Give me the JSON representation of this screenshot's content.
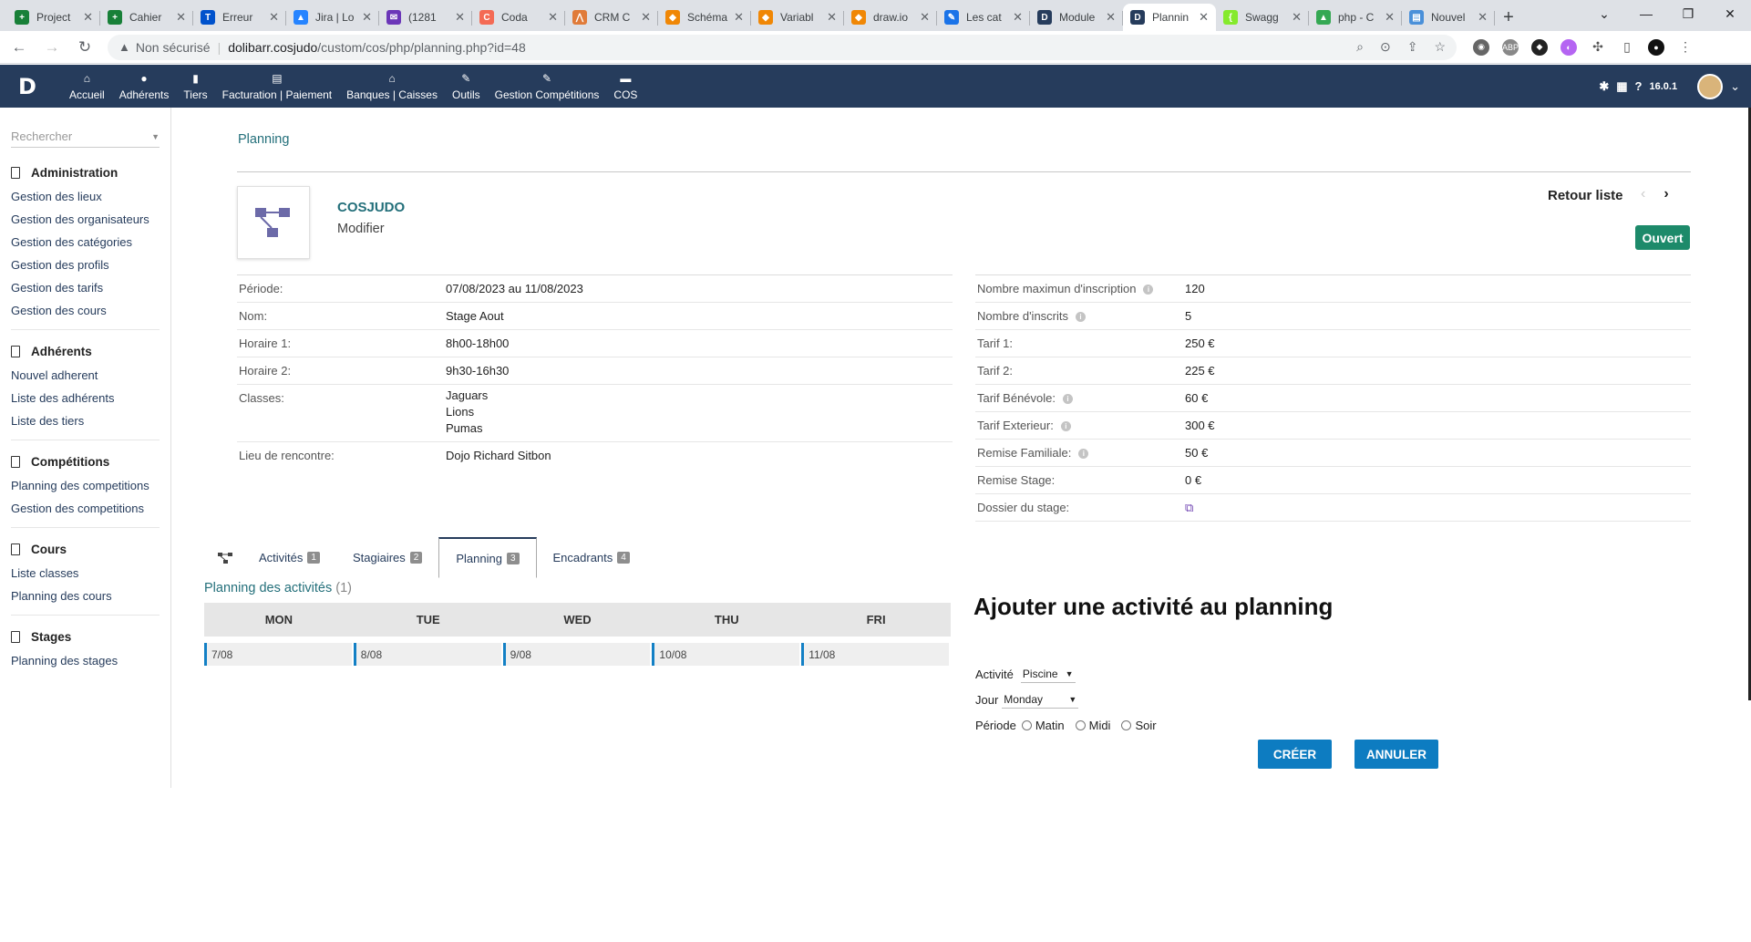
{
  "browser": {
    "tabs": [
      {
        "title": "Project",
        "color": "#188038",
        "glyph": "+"
      },
      {
        "title": "Cahier",
        "color": "#188038",
        "glyph": "+"
      },
      {
        "title": "Erreur",
        "color": "#0052cc",
        "glyph": "T"
      },
      {
        "title": "Jira | Lo",
        "color": "#2684ff",
        "glyph": "▲"
      },
      {
        "title": "(1281",
        "color": "#6b36b8",
        "glyph": "✉"
      },
      {
        "title": "Coda",
        "color": "#f46a54",
        "glyph": "C"
      },
      {
        "title": "CRM C",
        "color": "#e07b39",
        "glyph": "⋀"
      },
      {
        "title": "Schéma",
        "color": "#f08705",
        "glyph": "◆"
      },
      {
        "title": "Variabl",
        "color": "#f08705",
        "glyph": "◆"
      },
      {
        "title": "draw.io",
        "color": "#f08705",
        "glyph": "◆"
      },
      {
        "title": "Les cat",
        "color": "#1a73e8",
        "glyph": "✎"
      },
      {
        "title": "Module",
        "color": "#263c5c",
        "glyph": "D"
      },
      {
        "title": "Plannin",
        "color": "#263c5c",
        "glyph": "D"
      },
      {
        "title": "Swagg",
        "color": "#85ea2d",
        "glyph": "{"
      },
      {
        "title": "php - C",
        "color": "#34a853",
        "glyph": "▲"
      },
      {
        "title": "Nouvel",
        "color": "#4a90d9",
        "glyph": "▤"
      }
    ],
    "active_tab_index": 12,
    "new_tab": "+",
    "security_label": "Non sécurisé",
    "url_host": "dolibarr.cosjudo",
    "url_path": "/custom/cos/php/planning.php?id=48"
  },
  "topmenu": {
    "items": [
      {
        "label": "Accueil",
        "icon": "home-icon",
        "glyph": "⌂"
      },
      {
        "label": "Adhérents",
        "icon": "user-icon",
        "glyph": "●"
      },
      {
        "label": "Tiers",
        "icon": "building-icon",
        "glyph": "▮"
      },
      {
        "label": "Facturation | Paiement",
        "icon": "money-icon",
        "glyph": "▤"
      },
      {
        "label": "Banques | Caisses",
        "icon": "bank-icon",
        "glyph": "⌂"
      },
      {
        "label": "Outils",
        "icon": "wrench-icon",
        "glyph": "✎"
      },
      {
        "label": "Gestion Compétitions",
        "icon": "edit-icon",
        "glyph": "✎"
      },
      {
        "label": "COS",
        "icon": "file-icon",
        "glyph": "▬"
      }
    ],
    "version": "16.0.1"
  },
  "sidebar": {
    "search_placeholder": "Rechercher",
    "groups": [
      {
        "title": "Administration",
        "items": [
          "Gestion des lieux",
          "Gestion des organisateurs",
          "Gestion des catégories",
          "Gestion des profils",
          "Gestion des tarifs",
          "Gestion des cours"
        ]
      },
      {
        "title": "Adhérents",
        "items": [
          "Nouvel adherent",
          "Liste des adhérents",
          "Liste des tiers"
        ]
      },
      {
        "title": "Compétitions",
        "items": [
          "Planning des competitions",
          "Gestion des competitions"
        ]
      },
      {
        "title": "Cours",
        "items": [
          "Liste classes",
          "Planning des cours"
        ]
      },
      {
        "title": "Stages",
        "items": [
          "Planning des stages"
        ]
      }
    ]
  },
  "page": {
    "breadcrumb": "Planning",
    "object_name": "COSJUDO",
    "object_sub": "Modifier",
    "back_label": "Retour liste",
    "status": "Ouvert",
    "status_color": "#1d8a6a"
  },
  "left_fields": {
    "periode": {
      "label": "Période:",
      "value": "07/08/2023 au 11/08/2023"
    },
    "nom": {
      "label": "Nom:",
      "value": "Stage Aout"
    },
    "horaire1": {
      "label": "Horaire 1:",
      "value": "8h00-18h00"
    },
    "horaire2": {
      "label": "Horaire 2:",
      "value": "9h30-16h30"
    },
    "classes": {
      "label": "Classes:",
      "values": [
        "Jaguars",
        "Lions",
        "Pumas"
      ]
    },
    "lieu": {
      "label": "Lieu de rencontre:",
      "value": "Dojo Richard Sitbon"
    }
  },
  "right_fields": {
    "max": {
      "label": "Nombre maximun d'inscription",
      "value": "120"
    },
    "inscrits": {
      "label": "Nombre d'inscrits",
      "value": "5"
    },
    "tarif1": {
      "label": "Tarif 1:",
      "value": "250 €"
    },
    "tarif2": {
      "label": "Tarif 2:",
      "value": "225 €"
    },
    "benevole": {
      "label": "Tarif Bénévole:",
      "value": "60 €"
    },
    "exterieur": {
      "label": "Tarif Exterieur:",
      "value": "300 €"
    },
    "familiale": {
      "label": "Remise Familiale:",
      "value": "50 €"
    },
    "stage": {
      "label": "Remise Stage:",
      "value": "0 €"
    },
    "dossier": {
      "label": "Dossier du stage:"
    }
  },
  "tabs": [
    {
      "label": "Activités",
      "count": "1"
    },
    {
      "label": "Stagiaires",
      "count": "2"
    },
    {
      "label": "Planning",
      "count": "3"
    },
    {
      "label": "Encadrants",
      "count": "4"
    }
  ],
  "planning": {
    "title": "Planning des activités",
    "count": "(1)",
    "days": [
      "MON",
      "TUE",
      "WED",
      "THU",
      "FRI"
    ],
    "dates": [
      "7/08",
      "8/08",
      "9/08",
      "10/08",
      "11/08"
    ]
  },
  "add_form": {
    "title": "Ajouter une activité au planning",
    "activite_label": "Activité",
    "activite_value": "Piscine",
    "jour_label": "Jour",
    "jour_value": "Monday",
    "periode_label": "Période",
    "periode_options": [
      "Matin",
      "Midi",
      "Soir"
    ],
    "create_label": "CRÉER",
    "cancel_label": "ANNULER"
  }
}
